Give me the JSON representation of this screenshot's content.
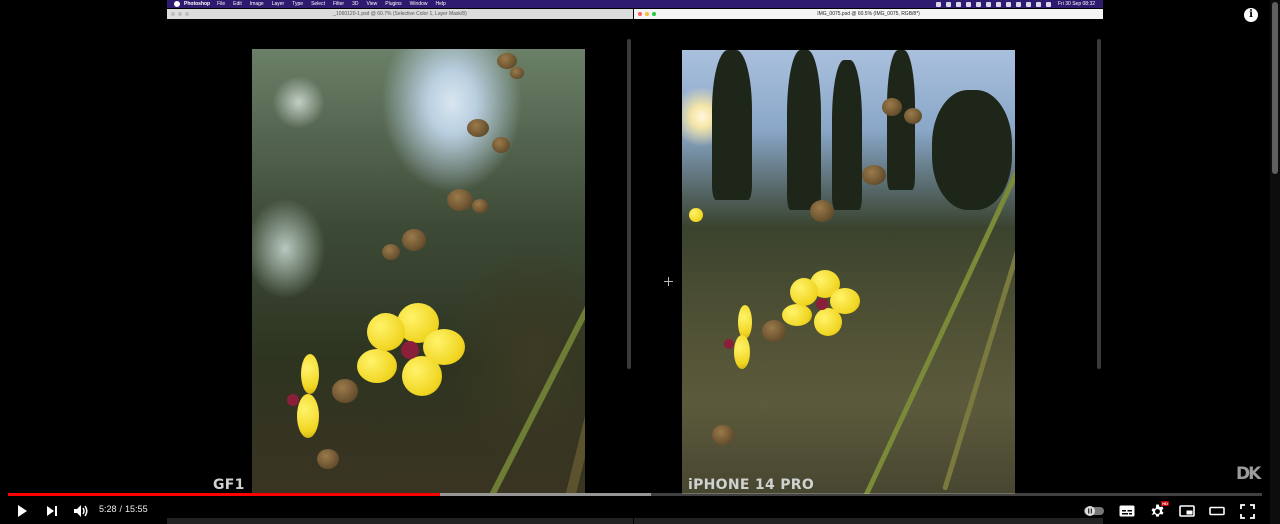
{
  "mac_menubar": {
    "app_name": "Photoshop",
    "menus": [
      "File",
      "Edit",
      "Image",
      "Layer",
      "Type",
      "Select",
      "Filter",
      "3D",
      "View",
      "Plugins",
      "Window",
      "Help"
    ],
    "clock": "Fri 30 Sep  08:32",
    "background": "#2e1a6e"
  },
  "photoshop": {
    "left_window_title": "_1060120-1.psd @ 60.7% (Selective Color 1, Layer Mask/8)",
    "right_window_title": "IMG_0075.psd @ 60.5% (IMG_0075, RGB/8*)",
    "left_caption": "GF1",
    "right_caption": "iPHONE 14 PRO"
  },
  "player": {
    "info_icon": "i",
    "watermark": "DK",
    "current_time": "5:28",
    "duration": "15:55",
    "time_separator": "/",
    "played_fraction": 0.3445,
    "loaded_fraction": 0.513,
    "progress_color": "#ff0000",
    "hd_badge": "HD"
  }
}
